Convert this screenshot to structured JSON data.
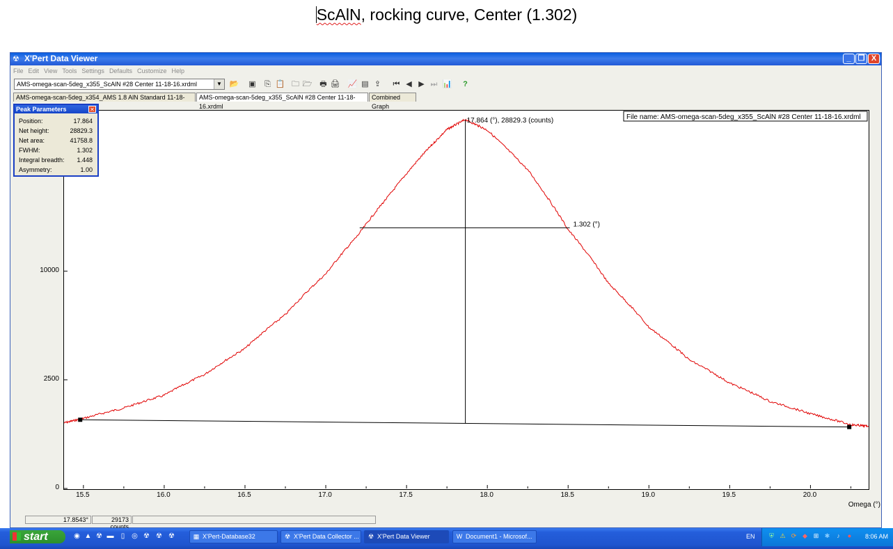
{
  "document": {
    "heading_word1": "ScAlN",
    "heading_rest": ", rocking curve, Center (1.302)"
  },
  "window": {
    "title": "X'Pert Data Viewer",
    "controls": {
      "minimize": "_",
      "restore": "❐",
      "close": "X"
    }
  },
  "menu": [
    "File",
    "Edit",
    "View",
    "Tools",
    "Settings",
    "Defaults",
    "Customize",
    "Help"
  ],
  "toolbar": {
    "file_value": "AMS-omega-scan-5deg_x355_ScAlN #28 Center 11-18-16.xrdml",
    "icons": [
      "open-folder-icon",
      "properties-icon",
      "copy-icon",
      "paste-icon",
      "folder-icon",
      "folder-open-icon",
      "print-icon",
      "print-preview-icon",
      "graph-icon",
      "table-icon",
      "export-icon",
      "first-icon",
      "previous-icon",
      "next-icon",
      "last-icon",
      "chart-icon",
      "help-icon"
    ]
  },
  "tabs": [
    {
      "label": "AMS-omega-scan-5deg_x354_AMS 1.8 AlN Standard 11-18-16.xrdml",
      "active": false
    },
    {
      "label": "AMS-omega-scan-5deg_x355_ScAlN #28 Center 11-18-16.xrdml",
      "active": true
    },
    {
      "label": "Combined Graph",
      "active": false
    }
  ],
  "peak_panel": {
    "title": "Peak Parameters",
    "rows": [
      {
        "label": "Position:",
        "value": "17.864"
      },
      {
        "label": "Net height:",
        "value": "28829.3"
      },
      {
        "label": "Net area:",
        "value": "41758.8"
      },
      {
        "label": "FWHM:",
        "value": "1.302"
      },
      {
        "label": "Integral breadth:",
        "value": "1.448"
      },
      {
        "label": "Asymmetry:",
        "value": "1.00"
      }
    ]
  },
  "chart_data": {
    "type": "line",
    "file_label": "File name: AMS-omega-scan-5deg_x355_ScAlN #28 Center 11-18-16.xrdml",
    "xlabel": "Omega (°)",
    "ylabel": "",
    "y_scale": "sqrt",
    "xlim": [
      15.38,
      20.36
    ],
    "ylim": [
      0,
      29800
    ],
    "x_ticks": [
      15.5,
      16.0,
      16.5,
      17.0,
      17.5,
      18.0,
      18.5,
      19.0,
      19.5,
      20.0
    ],
    "x_tick_labels": [
      "15.5",
      "16.0",
      "16.5",
      "17.0",
      "17.5",
      "18.0",
      "18.5",
      "19.0",
      "19.5",
      "20.0"
    ],
    "y_ticks": [
      0,
      2500,
      10000
    ],
    "y_tick_labels": [
      "0",
      "2500",
      "10000"
    ],
    "series": [
      {
        "color": "#e00000",
        "x": [
          15.38,
          15.5,
          15.75,
          16.0,
          16.25,
          16.5,
          16.75,
          17.0,
          17.2,
          17.4,
          17.6,
          17.75,
          17.864,
          18.0,
          18.25,
          18.5,
          18.75,
          19.0,
          19.25,
          19.5,
          19.75,
          20.0,
          20.25,
          20.36
        ],
        "y": [
          910,
          1040,
          1370,
          1840,
          2750,
          4150,
          6400,
          9750,
          13600,
          18400,
          23600,
          27300,
          28829,
          27200,
          21500,
          14200,
          8900,
          5500,
          3500,
          2350,
          1600,
          1180,
          860,
          820
        ]
      }
    ],
    "baseline": {
      "x": [
        15.48,
        20.24
      ],
      "y": [
        1000,
        800
      ]
    },
    "peak_marker": {
      "x": 17.864,
      "y": 28829.3,
      "label": "17.864 (°), 28829.3 (counts)"
    },
    "fwhm_marker": {
      "x1": 17.21,
      "x2": 18.51,
      "y": 14400,
      "label": "1.302 (°)"
    }
  },
  "status": {
    "position": "17.8543°",
    "counts": "29173 counts"
  },
  "taskbar": {
    "start_label": "start",
    "tasks": [
      {
        "label": "X'Pert-Database32",
        "active": false
      },
      {
        "label": "X'Pert Data Collector ...",
        "active": false
      },
      {
        "label": "X'Pert Data Viewer",
        "active": true
      },
      {
        "label": "Document1 - Microsof...",
        "active": false
      }
    ],
    "language": "EN",
    "clock": "8:06 AM"
  }
}
